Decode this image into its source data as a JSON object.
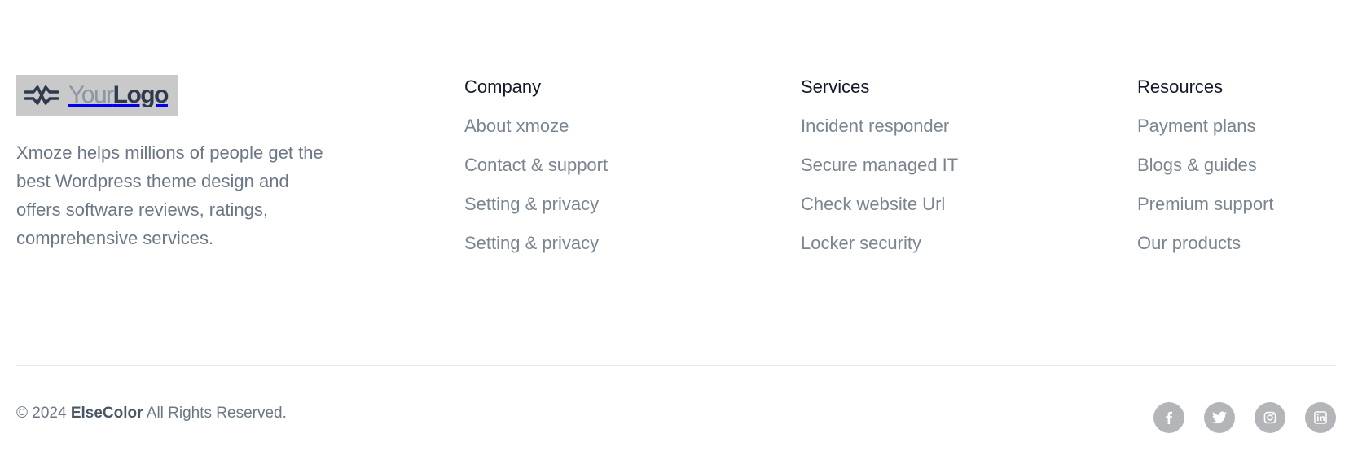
{
  "brand": {
    "logo_your": "Your",
    "logo_logo": "Logo",
    "description": "Xmoze helps millions of people get the best Wordpress theme design and offers software reviews, ratings, comprehensive services."
  },
  "columns": {
    "company": {
      "title": "Company",
      "links": [
        "About xmoze",
        "Contact & support",
        "Setting & privacy",
        "Setting & privacy"
      ]
    },
    "services": {
      "title": "Services",
      "links": [
        "Incident responder",
        "Secure managed IT",
        "Check website Url",
        "Locker security"
      ]
    },
    "resources": {
      "title": "Resources",
      "links": [
        "Payment plans",
        "Blogs & guides",
        "Premium support",
        "Our products"
      ]
    }
  },
  "bottom": {
    "copyright_prefix": "© 2024",
    "company_name": "ElseColor",
    "copyright_suffix": "All Rights Reserved."
  },
  "socials": [
    {
      "icon": "facebook-icon"
    },
    {
      "icon": "twitter-icon"
    },
    {
      "icon": "instagram-icon"
    },
    {
      "icon": "linkedin-icon"
    }
  ],
  "colors": {
    "logo_bg": "#c9c9c9",
    "logo_dark": "#2f3a4f",
    "heading": "#111827",
    "link": "#7a8591",
    "social_bg": "#b3b5b9"
  }
}
